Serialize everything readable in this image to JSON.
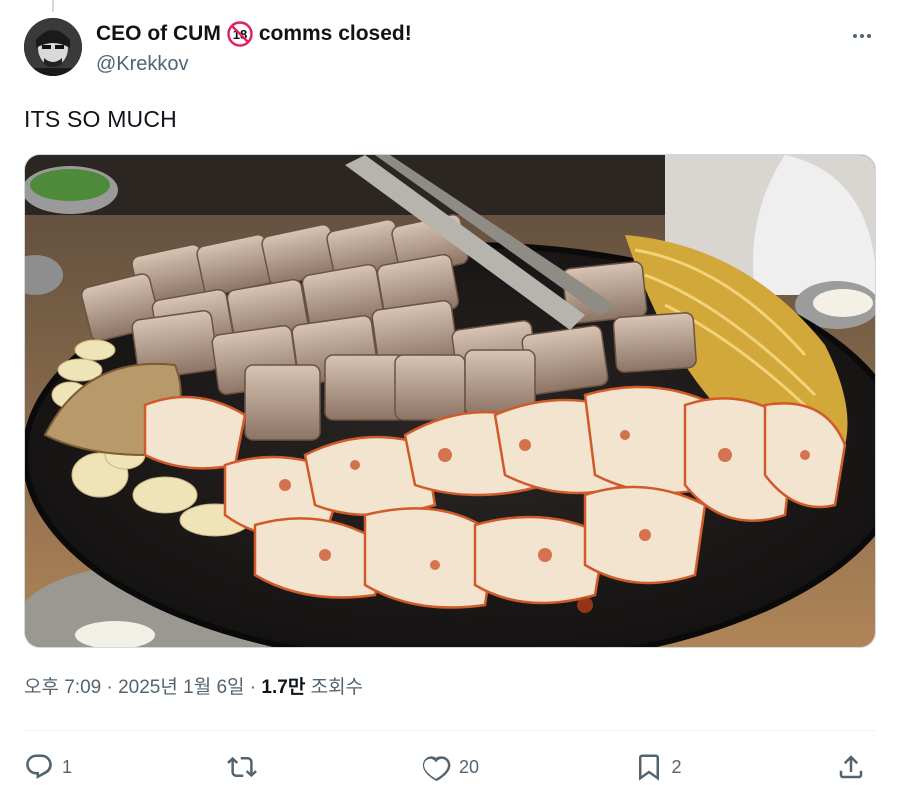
{
  "author": {
    "display_name_part1": "CEO of CUM",
    "badge_text": "18",
    "display_name_part2": "comms closed!",
    "handle": "@Krekkov"
  },
  "tweet": {
    "text": "ITS SO MUCH"
  },
  "meta": {
    "time": "오후 7:09",
    "separator": "·",
    "date": "2025년 1월 6일",
    "views_count": "1.7만",
    "views_label": "조회수"
  },
  "actions": {
    "replies": "1",
    "retweets": "",
    "likes": "20",
    "bookmarks": "2"
  },
  "icons": {
    "more": "more-horizontal-icon",
    "reply": "reply-icon",
    "retweet": "retweet-icon",
    "like": "heart-icon",
    "bookmark": "bookmark-icon",
    "share": "share-icon"
  },
  "colors": {
    "text": "#0f1419",
    "secondary": "#536471",
    "divider": "#eff3f4",
    "badge_red": "#e0245e"
  }
}
